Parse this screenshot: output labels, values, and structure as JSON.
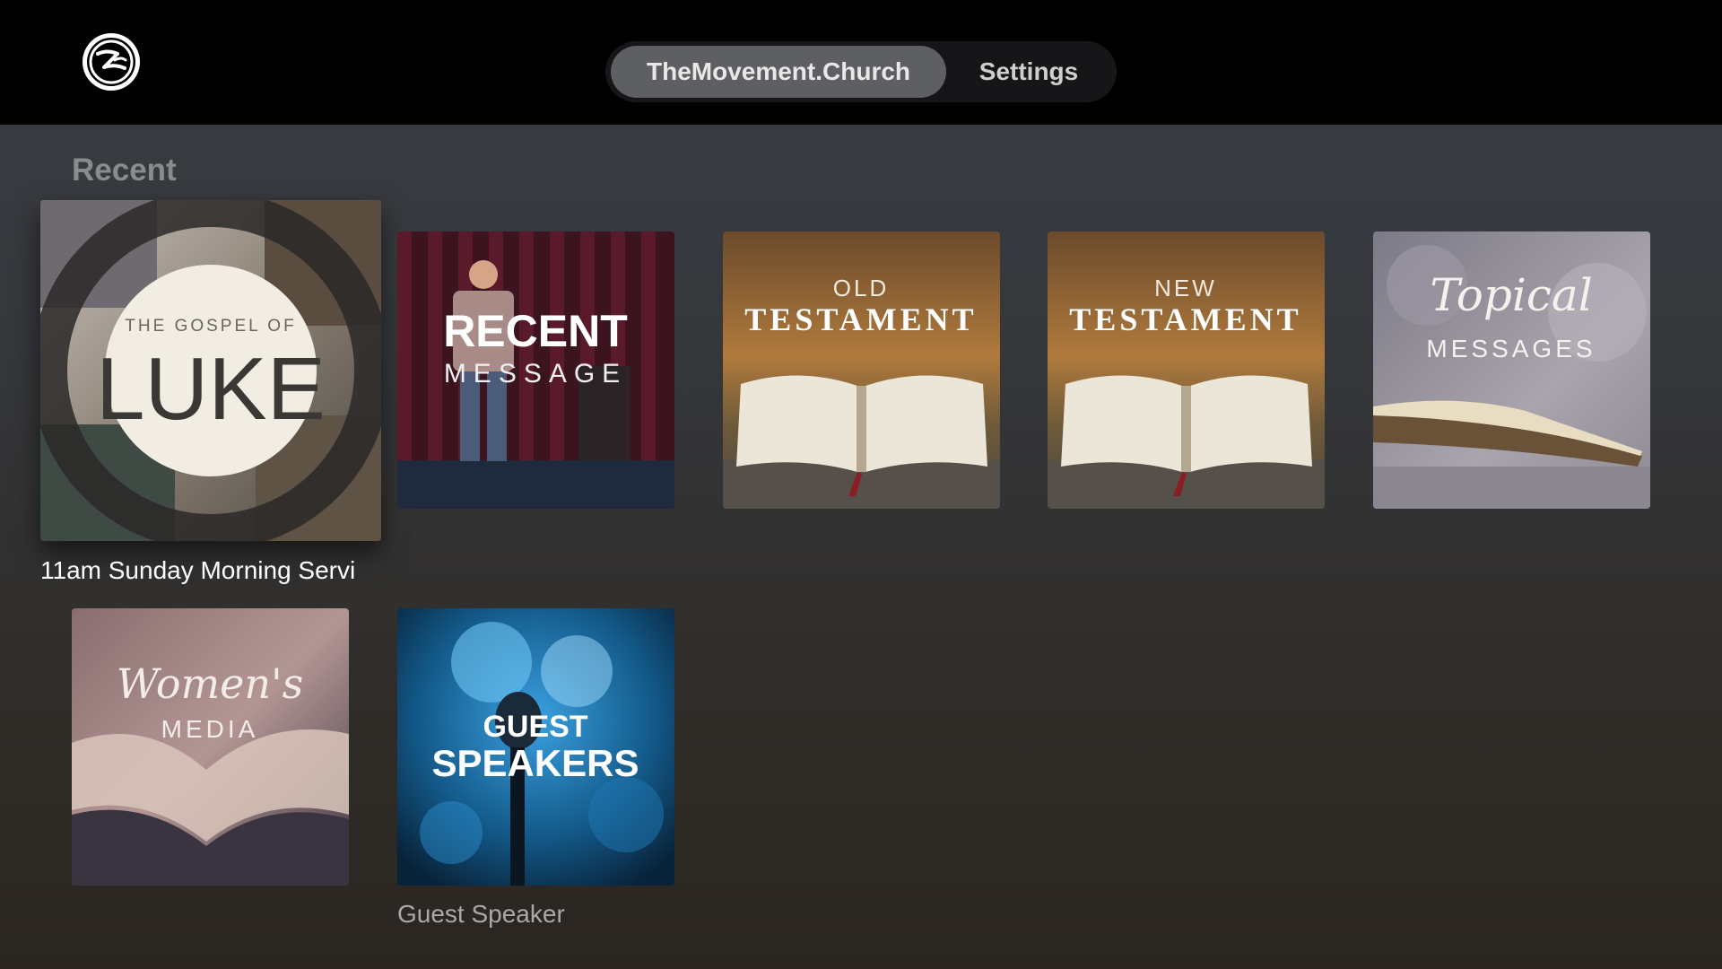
{
  "header": {
    "tabs": [
      {
        "label": "TheMovement.Church",
        "active": true
      },
      {
        "label": "Settings",
        "active": false
      }
    ]
  },
  "section": {
    "title": "Recent"
  },
  "items": [
    {
      "art_top": "THE GOSPEL OF",
      "art_main": "LUKE",
      "caption": "11am Sunday Morning Servi",
      "focused": true
    },
    {
      "art_top": "RECENT",
      "art_main": "MESSAGE",
      "caption": ""
    },
    {
      "art_top": "OLD",
      "art_main": "TESTAMENT",
      "caption": ""
    },
    {
      "art_top": "NEW",
      "art_main": "TESTAMENT",
      "caption": ""
    },
    {
      "art_top": "Topical",
      "art_main": "MESSAGES",
      "caption": ""
    },
    {
      "art_top": "Women's",
      "art_main": "MEDIA",
      "caption": ""
    },
    {
      "art_top": "GUEST",
      "art_main": "SPEAKERS",
      "caption": "Guest Speaker"
    }
  ],
  "colors": {
    "background": "#35373b",
    "topbar": "#000000",
    "active_tab": "#5e5f62",
    "caption_focused": "#ffffff",
    "caption": "#a9a9a9"
  },
  "icons": {
    "logo": "church-dove-logo"
  }
}
